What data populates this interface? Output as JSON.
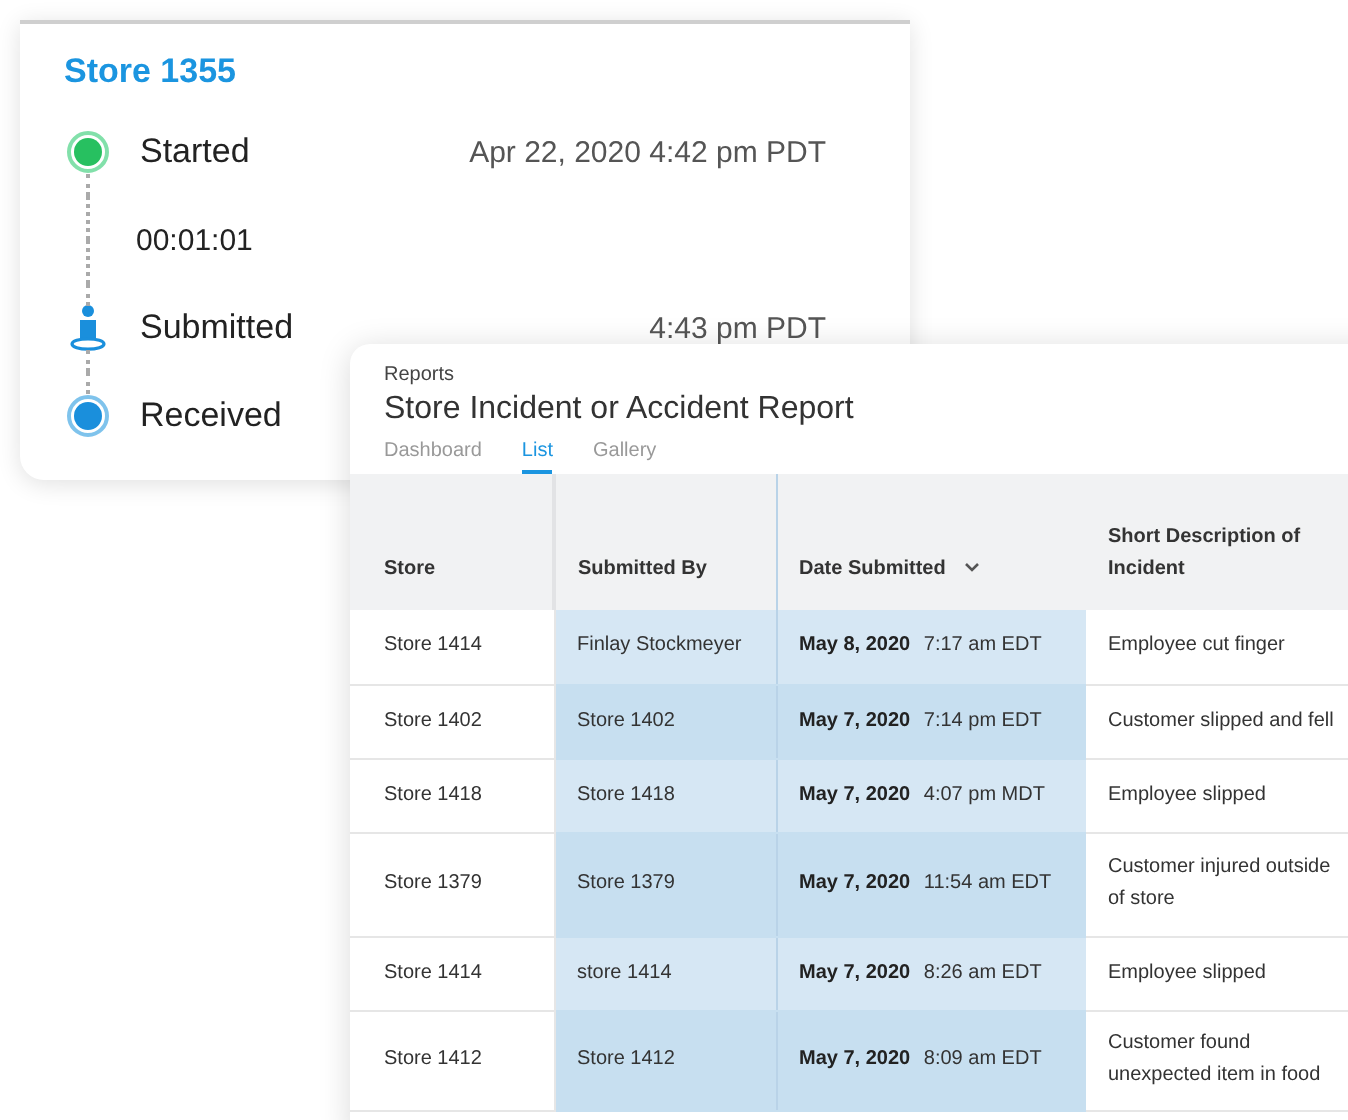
{
  "status_card": {
    "title": "Store 1355",
    "steps": [
      {
        "kind": "started",
        "label": "Started",
        "time": "Apr 22, 2020 4:42 pm PDT"
      },
      {
        "kind": "duration",
        "label": "00:01:01"
      },
      {
        "kind": "submitted",
        "label": "Submitted",
        "time": "4:43 pm PDT"
      },
      {
        "kind": "received",
        "label": "Received"
      }
    ]
  },
  "report": {
    "breadcrumb": "Reports",
    "title": "Store Incident or Accident Report",
    "tabs": [
      {
        "label": "Dashboard",
        "selected": false
      },
      {
        "label": "List",
        "selected": true
      },
      {
        "label": "Gallery",
        "selected": false
      }
    ],
    "table": {
      "columns": [
        {
          "label": "Store",
          "highlighted": false,
          "sorted": false
        },
        {
          "label": "Submitted By",
          "highlighted": true,
          "sorted": false
        },
        {
          "label": "Date Submitted",
          "highlighted": true,
          "sorted": true
        },
        {
          "label": "Short Description of Incident",
          "highlighted": false,
          "sorted": false
        }
      ],
      "rows": [
        [
          "Store 1414",
          "Finlay Stockmeyer",
          "**May 8, 2020**  7:17 am EDT",
          "Employee cut finger"
        ],
        [
          "Store 1402",
          "Store 1402",
          "**May 7, 2020**  7:14 pm EDT",
          "Customer slipped and fell"
        ],
        [
          "Store 1418",
          "Store 1418",
          "**May 7, 2020**  4:07 pm MDT",
          "Employee slipped"
        ],
        [
          "Store 1379",
          "Store 1379",
          "**May 7, 2020**  11:54 am EDT",
          "Customer injured outside of store"
        ],
        [
          "Store 1414",
          "store 1414",
          "**May 7, 2020**  8:26 am EDT",
          "Employee slipped"
        ],
        [
          "Store 1412",
          "Store 1412",
          "**May 7, 2020**  8:09 am EDT",
          "Customer found unexpected item in food"
        ]
      ]
    }
  }
}
